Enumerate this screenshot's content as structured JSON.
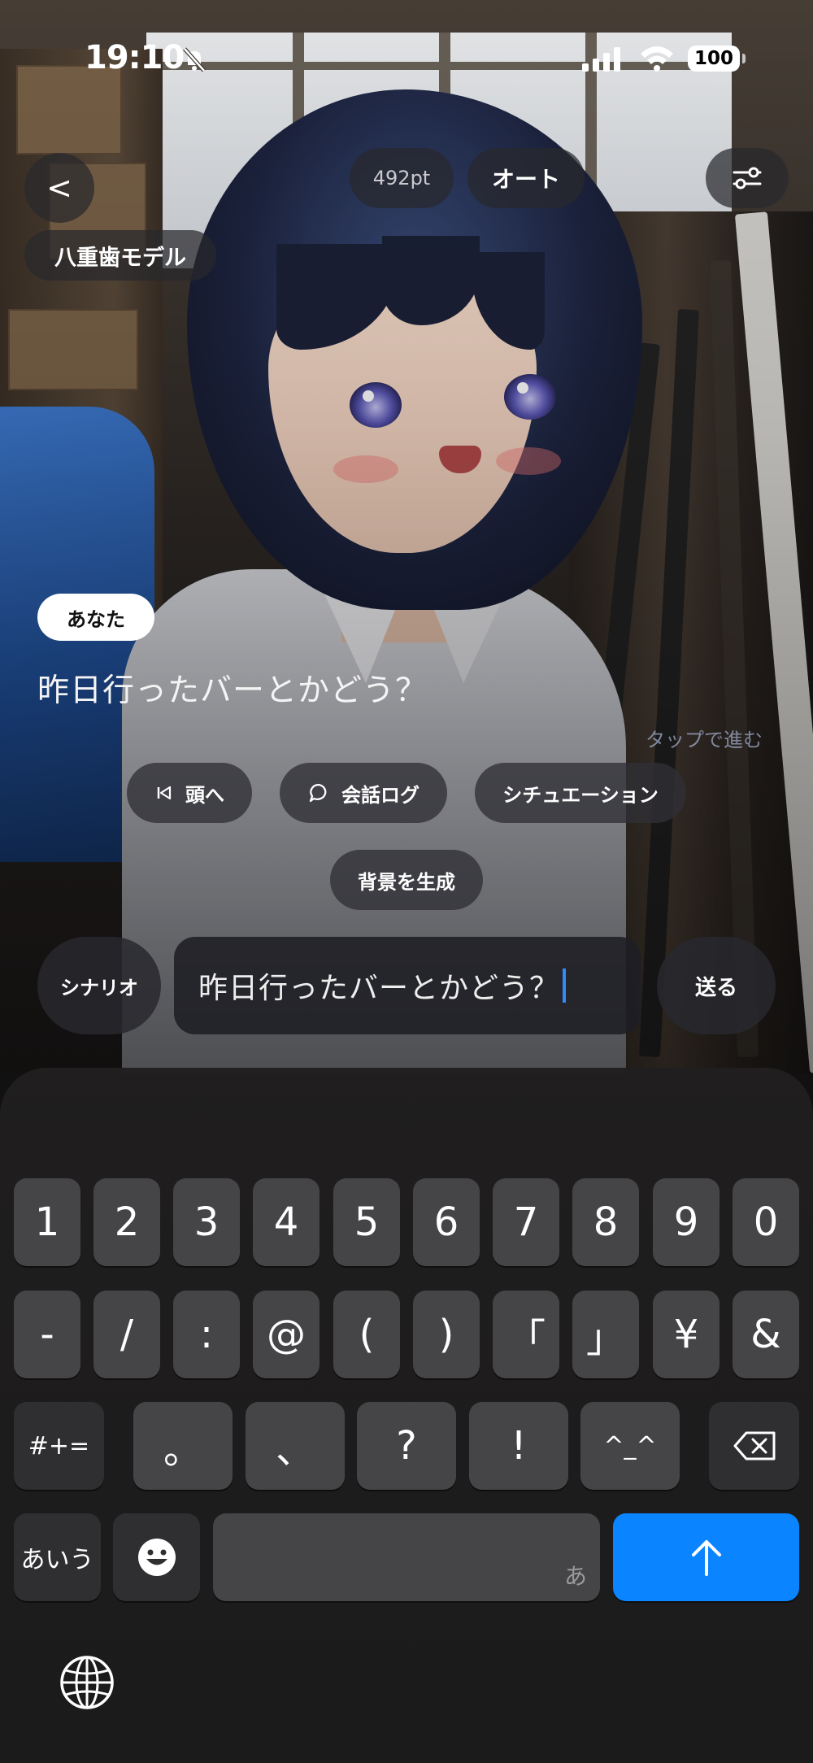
{
  "status": {
    "time": "19:10",
    "battery": "100"
  },
  "header": {
    "back_label": "<",
    "points": "492pt",
    "auto_label": "オート",
    "model_label": "八重歯モデル"
  },
  "dialogue": {
    "speaker": "あなた",
    "text": "昨日行ったバーとかどう？",
    "tap_hint": "タップで進む"
  },
  "actions": {
    "to_start": "頭へ",
    "log": "会話ログ",
    "situation": "シチュエーション",
    "generate_bg": "背景を生成"
  },
  "input": {
    "scenario_label": "シナリオ",
    "value": "昨日行ったバーとかどう？",
    "send_label": "送る"
  },
  "keyboard": {
    "row1": [
      "1",
      "2",
      "3",
      "4",
      "5",
      "6",
      "7",
      "8",
      "9",
      "0"
    ],
    "row2": [
      "-",
      "/",
      ":",
      "@",
      "(",
      ")",
      "「",
      "」",
      "¥",
      "&"
    ],
    "symbols_toggle": "#+=",
    "row3": [
      "。",
      "、",
      "?",
      "!",
      "^_^"
    ],
    "kana_toggle": "あいう",
    "space_hint": "あ"
  },
  "colors": {
    "caret": "#2f8cff",
    "return_key": "#0a84ff"
  },
  "icons": [
    "bell-off-icon",
    "signal-icon",
    "wifi-icon",
    "settings-sliders-icon",
    "skip-back-icon",
    "chat-bubble-icon",
    "emoji-icon",
    "backspace-icon",
    "return-arrow-icon",
    "globe-icon"
  ]
}
